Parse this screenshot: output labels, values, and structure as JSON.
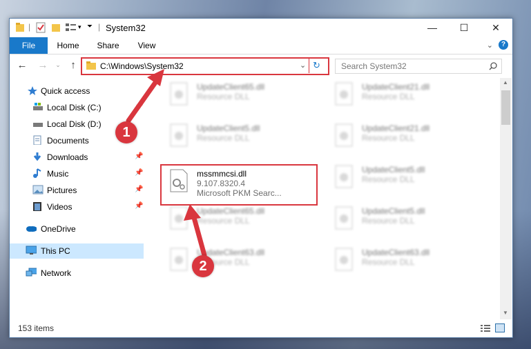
{
  "window": {
    "title": "System32"
  },
  "ribbon": {
    "tabs": [
      "File",
      "Home",
      "Share",
      "View"
    ],
    "help": "?"
  },
  "address": {
    "path": "C:\\Windows\\System32"
  },
  "search": {
    "placeholder": "Search System32"
  },
  "nav": {
    "items": [
      {
        "label": "Quick access",
        "icon": "star-icon"
      },
      {
        "label": "Local Disk (C:)",
        "icon": "drive-icon",
        "pinned": true
      },
      {
        "label": "Local Disk (D:)",
        "icon": "drive-icon"
      },
      {
        "label": "Documents",
        "icon": "documents-icon"
      },
      {
        "label": "Downloads",
        "icon": "download-icon",
        "pinned": true
      },
      {
        "label": "Music",
        "icon": "music-icon",
        "pinned": true
      },
      {
        "label": "Pictures",
        "icon": "pictures-icon",
        "pinned": true
      },
      {
        "label": "Videos",
        "icon": "videos-icon",
        "pinned": true
      },
      {
        "label": "OneDrive",
        "icon": "cloud-icon"
      },
      {
        "label": "This PC",
        "icon": "computer-icon",
        "selected": true
      },
      {
        "label": "Network",
        "icon": "network-icon"
      }
    ]
  },
  "files": [
    {
      "name": "UpdateClient65.dll",
      "type": "Resource DLL"
    },
    {
      "name": "UpdateClient21.dll",
      "type": "Resource DLL"
    },
    {
      "name": "UpdateClient5.dll",
      "type": "Resource DLL"
    },
    {
      "name": "UpdateClient21.dll",
      "type": "Resource DLL"
    },
    {
      "name": "mssmmcsi.dll",
      "version": "9.107.8320.4",
      "description": "Microsoft PKM Searc...",
      "selected": true
    },
    {
      "name": "UpdateClient5.dll",
      "type": "Resource DLL"
    },
    {
      "name": "UpdateClient65.dll",
      "type": "Resource DLL"
    },
    {
      "name": "UpdateClient5.dll",
      "type": "Resource DLL"
    },
    {
      "name": "UpdateClient63.dll",
      "type": "Resource DLL"
    },
    {
      "name": "UpdateClient63.dll",
      "type": "Resource DLL"
    }
  ],
  "status": {
    "item_count": "153 items"
  },
  "annotations": {
    "marker1": "1",
    "marker2": "2",
    "color": "#d9363e"
  }
}
